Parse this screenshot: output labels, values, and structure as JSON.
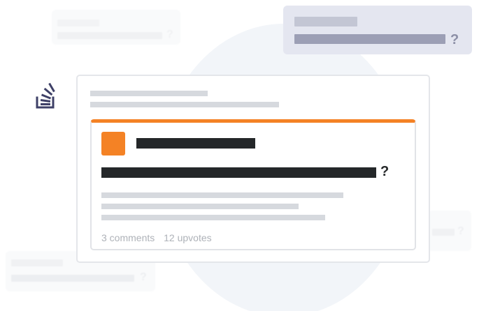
{
  "ghost_cards": {
    "top_left_q": "?",
    "top_right_q": "?",
    "bottom_left_q": "?",
    "bottom_right_q": "?"
  },
  "logo": {
    "icon": "stack-overflow-logo-icon",
    "color": "#3e4067"
  },
  "question": {
    "title_suffix": "?",
    "comments": "3 comments",
    "upvotes": "12 upvotes",
    "accent_color": "#f48225"
  }
}
